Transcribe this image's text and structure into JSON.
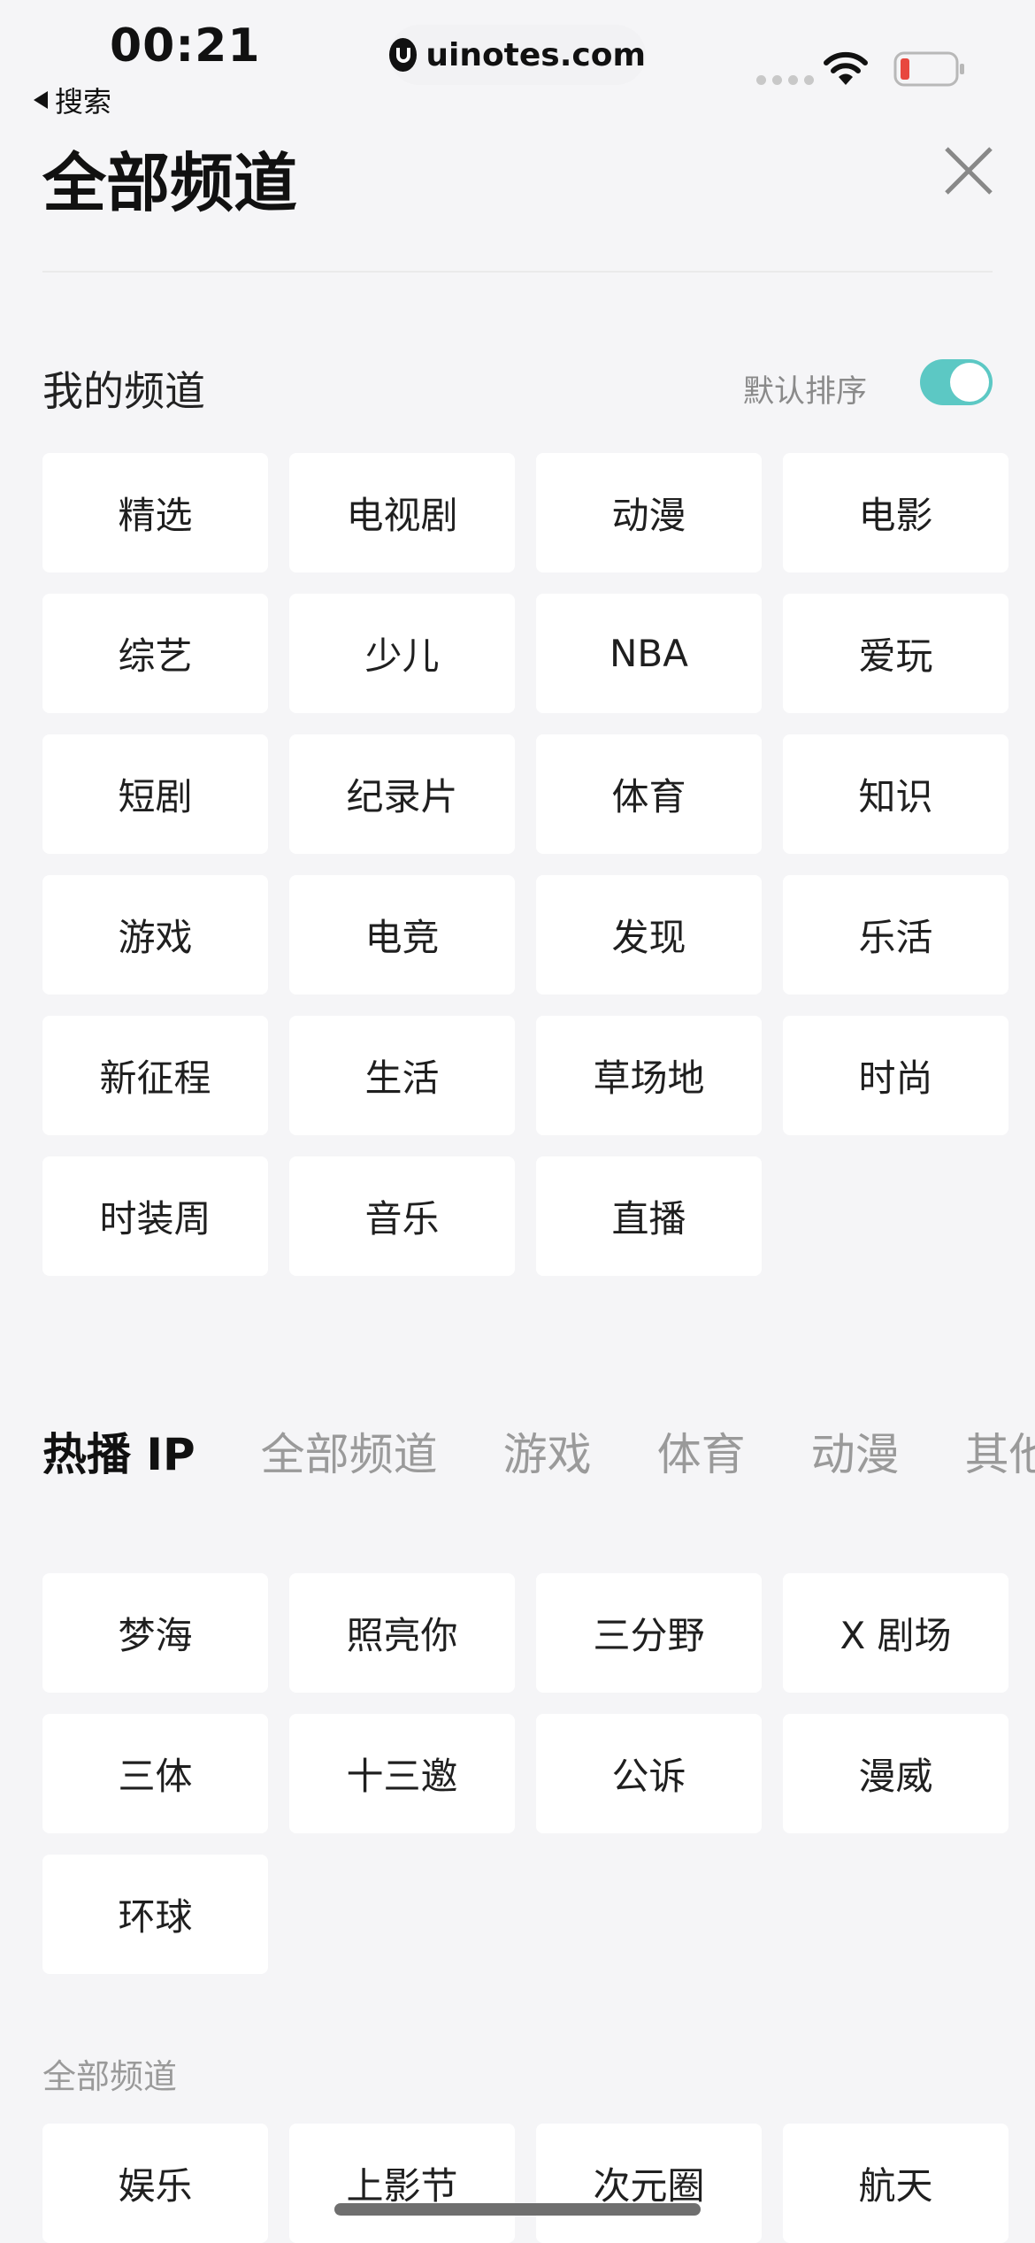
{
  "status_bar": {
    "time": "00:21",
    "back_label": "搜索",
    "url": "uinotes.com",
    "battery_color": "#e8473e"
  },
  "header": {
    "title": "全部频道",
    "close_icon": "close-icon"
  },
  "my_channels": {
    "title": "我的频道",
    "sort_label": "默认排序",
    "sort_enabled": true,
    "toggle_color": "#5cc8c4",
    "items": [
      "精选",
      "电视剧",
      "动漫",
      "电影",
      "综艺",
      "少儿",
      "NBA",
      "爱玩",
      "短剧",
      "纪录片",
      "体育",
      "知识",
      "游戏",
      "电竞",
      "发现",
      "乐活",
      "新征程",
      "生活",
      "草场地",
      "时尚",
      "时装周",
      "音乐",
      "直播"
    ]
  },
  "tabs": {
    "active_index": 0,
    "items": [
      "热播 IP",
      "全部频道",
      "游戏",
      "体育",
      "动漫",
      "其他"
    ]
  },
  "hot_ip": {
    "items": [
      "梦海",
      "照亮你",
      "三分野",
      "X 剧场",
      "三体",
      "十三邀",
      "公诉",
      "漫威",
      "环球"
    ]
  },
  "all_channels": {
    "label": "全部频道",
    "items": [
      "娱乐",
      "上影节",
      "次元圈",
      "航天"
    ]
  }
}
